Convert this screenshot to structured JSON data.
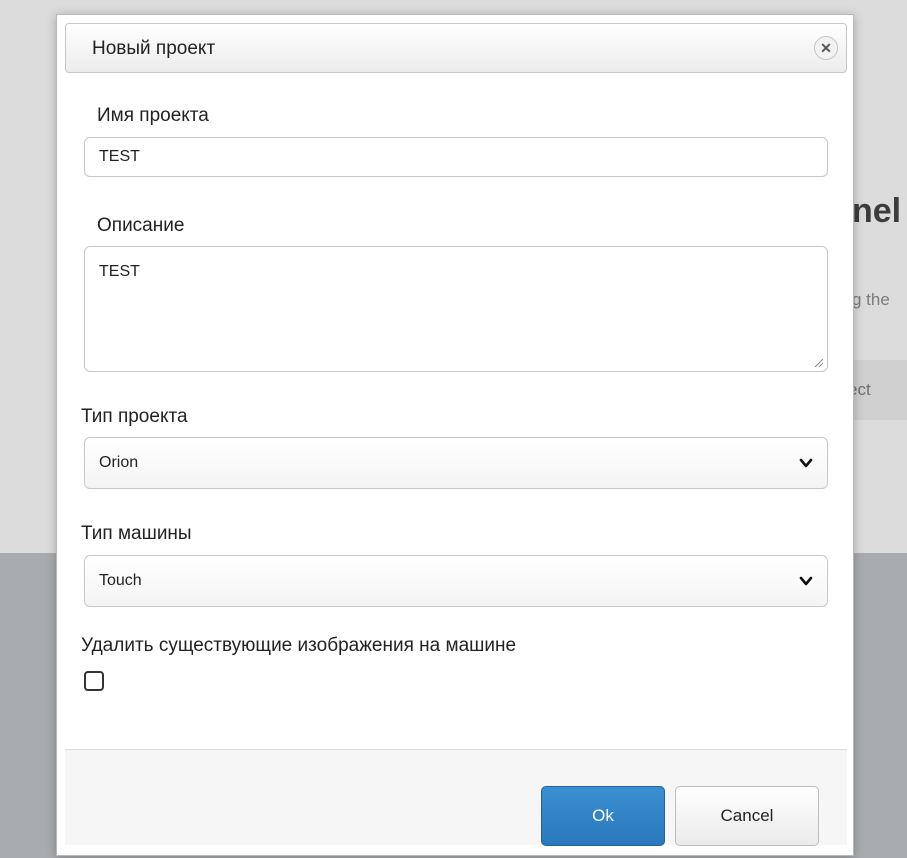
{
  "background": {
    "heading_fragment": "nel",
    "sub_fragment": "g the",
    "bar_fragment": "ect"
  },
  "modal": {
    "title": "Новый проект",
    "close_icon": "close-icon",
    "project_name": {
      "label": "Имя проекта",
      "value": "TEST"
    },
    "description": {
      "label": "Описание",
      "value": "TEST"
    },
    "project_type": {
      "label": "Тип проекта",
      "selected": "Orion"
    },
    "machine_type": {
      "label": "Тип машины",
      "selected": "Touch"
    },
    "delete_images": {
      "label": "Удалить существующие изображения на машине",
      "checked": false
    },
    "buttons": {
      "ok": "Ok",
      "cancel": "Cancel"
    }
  },
  "colors": {
    "primary_button": "#2a7fc4",
    "overlay_top": "#dcdcdc",
    "overlay_bottom": "#a9acaf"
  }
}
